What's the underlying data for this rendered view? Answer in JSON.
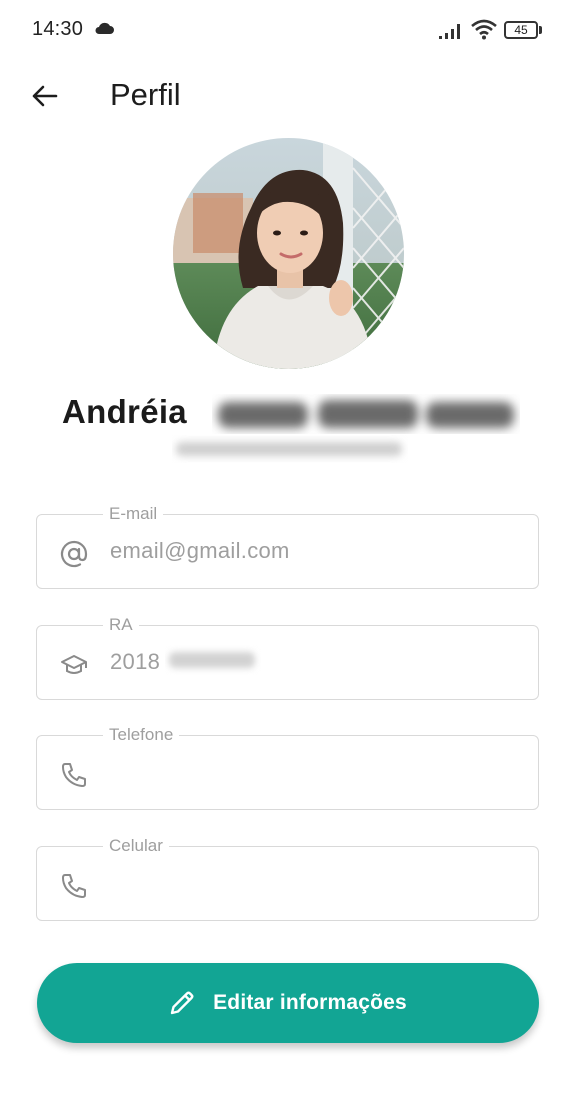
{
  "status_bar": {
    "time": "14:30",
    "battery_level": "45"
  },
  "header": {
    "title": "Perfil"
  },
  "profile": {
    "first_name": "Andréia"
  },
  "fields": {
    "email": {
      "label": "E-mail",
      "value": "email@gmail.com",
      "icon": "at-icon"
    },
    "ra": {
      "label": "RA",
      "value": "2018",
      "icon": "graduation-cap-icon"
    },
    "telefone": {
      "label": "Telefone",
      "value": "",
      "icon": "phone-icon"
    },
    "celular": {
      "label": "Celular",
      "value": "",
      "icon": "phone-icon"
    }
  },
  "actions": {
    "edit_label": "Editar informações"
  },
  "colors": {
    "accent": "#12a594",
    "label_gray": "#9e9e9e",
    "border": "#d9d9d9"
  }
}
